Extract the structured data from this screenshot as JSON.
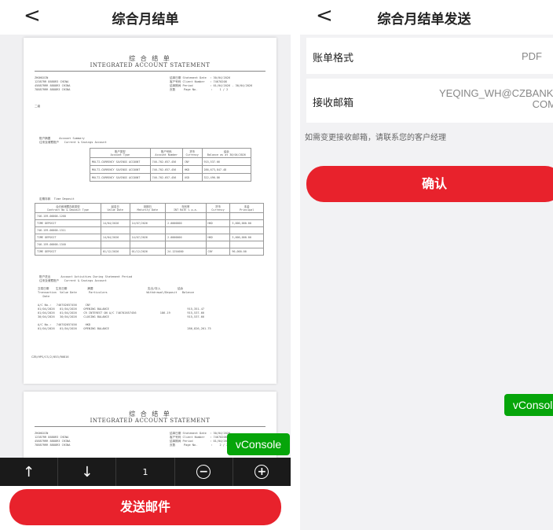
{
  "left": {
    "nav": {
      "back": "<",
      "title": "综合月结单"
    },
    "page1": {
      "header_cn": "综 合 结 单",
      "header_en": "INTEGRATED ACCOUNT STATEMENT",
      "addr_left": "ZHONGXIN\n12387RR 8888R3 CHINA\n45887RRR 8888R3 CHINA\n78887RRR 8888R3 CHINA",
      "addr_right": "结单日期 Statement Date  : 30/04/2026\n客户号码 Client Number   : 74670208\n结单期间 Period          : 01/04/2026 - 30/04/2026\n页数     Page No.        :    1 / 2",
      "note": "二级",
      "summary_label": "账户摘要     Account Summary\n往来及储蓄账户   Current & Savings Account",
      "summary_rows": [
        [
          "账户类型\nAccount Type",
          "账户号码\nAccount Number",
          "货币\nCurrency",
          "结余\nBalance as at 30/04/2026"
        ],
        [
          "MULTI-CURRENCY SAVINGS ACCOUNT",
          "746-702-657-456",
          "CNY",
          "915,537.66"
        ],
        [
          "MULTI-CURRENCY SAVINGS ACCOUNT",
          "746-702-657-456",
          "HKD",
          "286,673,847.48"
        ],
        [
          "MULTI-CURRENCY SAVINGS ACCOUNT",
          "746-702-657-456",
          "USD",
          "322,496.86"
        ]
      ],
      "deposit_label": "定期存款  Time Deposit",
      "deposit_rows": [
        [
          "合约和储蓄存款类型\nContract No & Deposit Type",
          "起息日\nValue Date",
          "到期日\nMaturity Date",
          "年利率\nINT RATE % p.a.",
          "货币\nCurrency",
          "本金\nPrincipal"
        ],
        [
          "746-159-00000-1268",
          "",
          "",
          "",
          "",
          ""
        ],
        [
          "TIME DEPOSIT",
          "14/04/2026",
          "14/07/2026",
          "2.0000000",
          "HKD",
          "3,000,000.00"
        ],
        [
          "746-159-00000-1311",
          "",
          "",
          "",
          "",
          ""
        ],
        [
          "TIME DEPOSIT",
          "14/04/2026",
          "14/07/2026",
          "2.0000000",
          "HKD",
          "3,000,000.00"
        ],
        [
          "746-159-00000-1340",
          "",
          "",
          "",
          "",
          ""
        ],
        [
          "TIME DEPOSIT",
          "01/12/2026",
          "01/12/2026",
          "24.1254000",
          "CNY",
          "90,000.00"
        ]
      ],
      "activity_label": "账户进出      Account Activities During Statement Period\n往来及储蓄账户   Current & Savings Account",
      "activity_head": "交易日期    生效日期            摘要                                支出/存入          结余\nTransaction  Value Date       Particulars                       Withdrawal/Deposit   Balance\n   Date",
      "activity_body": "A/C No.:   746702657456     CNY\n01/04/2026   01/04/2026    OPENING BALANCE                                              915,351.47\n01/04/2026   01/04/2026    CR INTEREST ON A/C 746702657456              186.19          915,537.66\n30/04/2026   30/04/2026    CLOSING BALANCE                                              915,537.66\n\nA/C No.:   746702657456     HKD\n01/04/2026   01/04/2026    OPENING BALANCE                                              286,826,261.75",
      "footer": "CZB/HPS/CS/2/053/R0816"
    },
    "page2": {
      "header_cn": "综 合 结 单",
      "header_en": "INTEGRATED ACCOUNT STATEMENT",
      "addr_left": "ZHONGXIN\n12387RR 8888R3 CHINA\n45887RRR 8888R3 CHINA\n78887RRR 8888R3 CHINA",
      "addr_right": "结单日期 Statement Date  : 30/04/2026\n客户号码 Client Number   : 74670208\n结单期间 Period          : 01/04/2026 - 30/04/2026\n页数     Page No.        :    2 / 2"
    },
    "vconsole": "vConsole",
    "toolbar": {
      "up": "↑",
      "down": "↓",
      "page": "1",
      "zoom_out": "−",
      "zoom_in": "+"
    },
    "send_button": "发送邮件"
  },
  "right": {
    "nav": {
      "back": "<",
      "title": "综合月结单发送"
    },
    "format_label": "账单格式",
    "format_value": "PDF",
    "email_label": "接收邮箱",
    "email_value": "YEQING_WH@CZBANK.\nCOM",
    "hint": "如需变更接收邮箱，请联系您的客户经理",
    "confirm_button": "确认",
    "vconsole": "vConsole"
  }
}
